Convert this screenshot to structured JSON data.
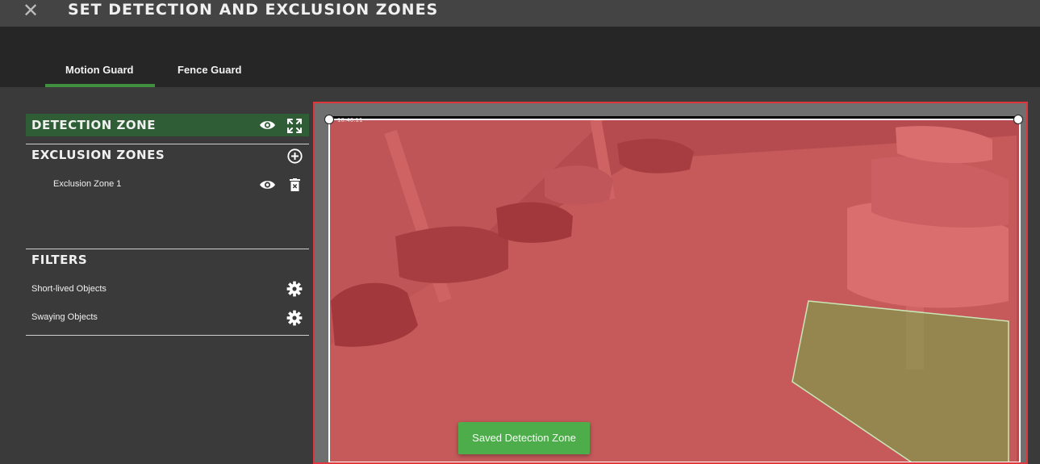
{
  "header": {
    "title": "SET DETECTION AND EXCLUSION ZONES",
    "close_icon": "close-icon"
  },
  "tabs": [
    {
      "label": "Motion Guard",
      "active": true
    },
    {
      "label": "Fence Guard",
      "active": false
    }
  ],
  "detection_zone": {
    "title": "DETECTION ZONE",
    "icons": [
      "eye-icon",
      "fullscreen-icon"
    ]
  },
  "exclusion_zones": {
    "title": "EXCLUSION ZONES",
    "add_icon": "plus-circle-icon",
    "items": [
      {
        "label": "Exclusion Zone 1",
        "icons": [
          "eye-icon",
          "delete-icon"
        ]
      }
    ]
  },
  "filters": {
    "title": "FILTERS",
    "items": [
      {
        "label": "Short-lived Objects",
        "icon": "gear-icon"
      },
      {
        "label": "Swaying Objects",
        "icon": "gear-icon"
      }
    ]
  },
  "camera": {
    "timestamp": "10:40:11"
  },
  "toast": {
    "message": "Saved Detection Zone"
  },
  "colors": {
    "accent_green": "#3f8f3f",
    "active_zone_bg": "#2f5e36",
    "detection_overlay": "#e0353a",
    "toast_bg": "#4dad4b"
  }
}
